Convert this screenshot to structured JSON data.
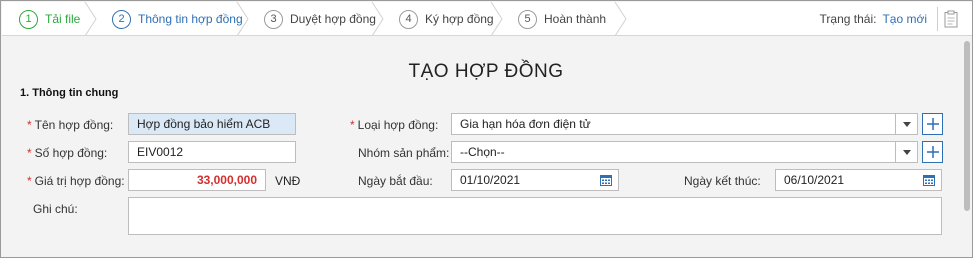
{
  "steps": [
    {
      "number": "1",
      "label": "Tải file"
    },
    {
      "number": "2",
      "label": "Thông tin hợp đồng"
    },
    {
      "number": "3",
      "label": "Duyệt hợp đồng"
    },
    {
      "number": "4",
      "label": "Ký hợp đồng"
    },
    {
      "number": "5",
      "label": "Hoàn thành"
    }
  ],
  "status": {
    "label": "Trạng thái:",
    "value": "Tạo mới"
  },
  "form": {
    "title": "TẠO HỢP ĐỒNG",
    "section": "1. Thông tin chung",
    "contract_name": {
      "label": "Tên hợp đồng:",
      "value": "Hợp đồng bảo hiểm ACB"
    },
    "contract_number": {
      "label": "Số hợp đồng:",
      "value": "EIV0012"
    },
    "contract_value": {
      "label": "Giá trị hợp đồng:",
      "value": "33,000,000",
      "unit": "VNĐ"
    },
    "contract_type": {
      "label": "Loại hợp đồng:",
      "value": "Gia hạn hóa đơn điện tử"
    },
    "product_group": {
      "label": "Nhóm sản phẩm:",
      "value": "--Chọn--"
    },
    "start_date": {
      "label": "Ngày bắt đầu:",
      "value": "01/10/2021"
    },
    "end_date": {
      "label": "Ngày kết thúc:",
      "value": "06/10/2021"
    },
    "notes": {
      "label": "Ghi chú:",
      "value": ""
    }
  },
  "colors": {
    "done": "#2aaa3c",
    "active": "#2f6fb3",
    "required": "#d32f2f",
    "accent": "#2f6fb3"
  }
}
